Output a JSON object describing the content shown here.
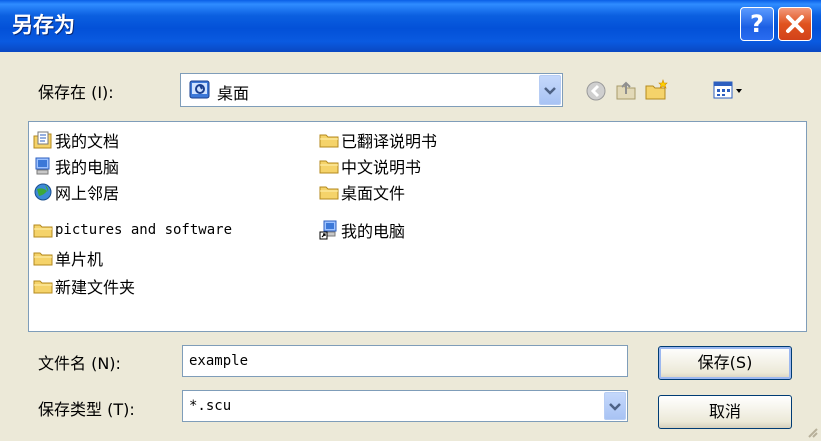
{
  "title": "另存为",
  "save_in": {
    "label": "保存在 (I):",
    "value": "桌面"
  },
  "files_left": [
    {
      "name": "我的文档",
      "icon": "my-documents-icon"
    },
    {
      "name": "我的电脑",
      "icon": "my-computer-icon"
    },
    {
      "name": "网上邻居",
      "icon": "network-places-icon"
    },
    {
      "name": "pictures and software",
      "icon": "folder-icon"
    },
    {
      "name": "单片机",
      "icon": "folder-icon"
    },
    {
      "name": "新建文件夹",
      "icon": "folder-icon"
    }
  ],
  "files_right": [
    {
      "name": "已翻译说明书",
      "icon": "folder-icon"
    },
    {
      "name": "中文说明书",
      "icon": "folder-icon"
    },
    {
      "name": "桌面文件",
      "icon": "folder-icon"
    },
    {
      "name": "我的电脑",
      "icon": "shortcut-icon"
    }
  ],
  "filename": {
    "label": "文件名 (N):",
    "value": "example"
  },
  "filetype": {
    "label": "保存类型 (T):",
    "value": "*.scu"
  },
  "buttons": {
    "save": "保存(S)",
    "cancel": "取消"
  },
  "colors": {
    "titlebar": "#0351d8",
    "face": "#ece9d8",
    "folder": "#f5d36a"
  }
}
